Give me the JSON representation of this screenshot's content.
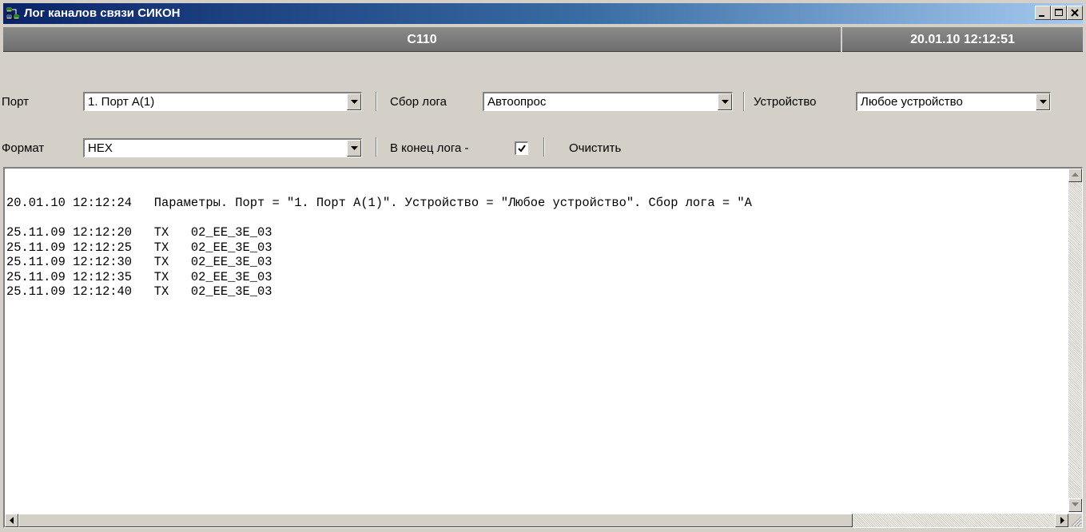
{
  "window": {
    "title": "Лог каналов связи СИКОН"
  },
  "header": {
    "device": "С110",
    "datetime": "20.01.10 12:12:51"
  },
  "toolbar1": {
    "port_label": "Порт",
    "port_value": "1. Порт А(1)",
    "collect_label": "Сбор лога",
    "collect_value": "Автоопрос",
    "device_label": "Устройство",
    "device_value": "Любое устройство"
  },
  "toolbar2": {
    "format_label": "Формат",
    "format_value": "HEX",
    "to_end_label": "В конец лога -",
    "to_end_checked": true,
    "clear_label": "Очистить"
  },
  "log": {
    "lines": [
      "20.01.10 12:12:24   Параметры. Порт = \"1. Порт А(1)\". Устройство = \"Любое устройство\". Сбор лога = \"А",
      "",
      "25.11.09 12:12:20   TX   02_EE_3E_03",
      "25.11.09 12:12:25   TX   02_EE_3E_03",
      "25.11.09 12:12:30   TX   02_EE_3E_03",
      "25.11.09 12:12:35   TX   02_EE_3E_03",
      "25.11.09 12:12:40   TX   02_EE_3E_03"
    ]
  }
}
